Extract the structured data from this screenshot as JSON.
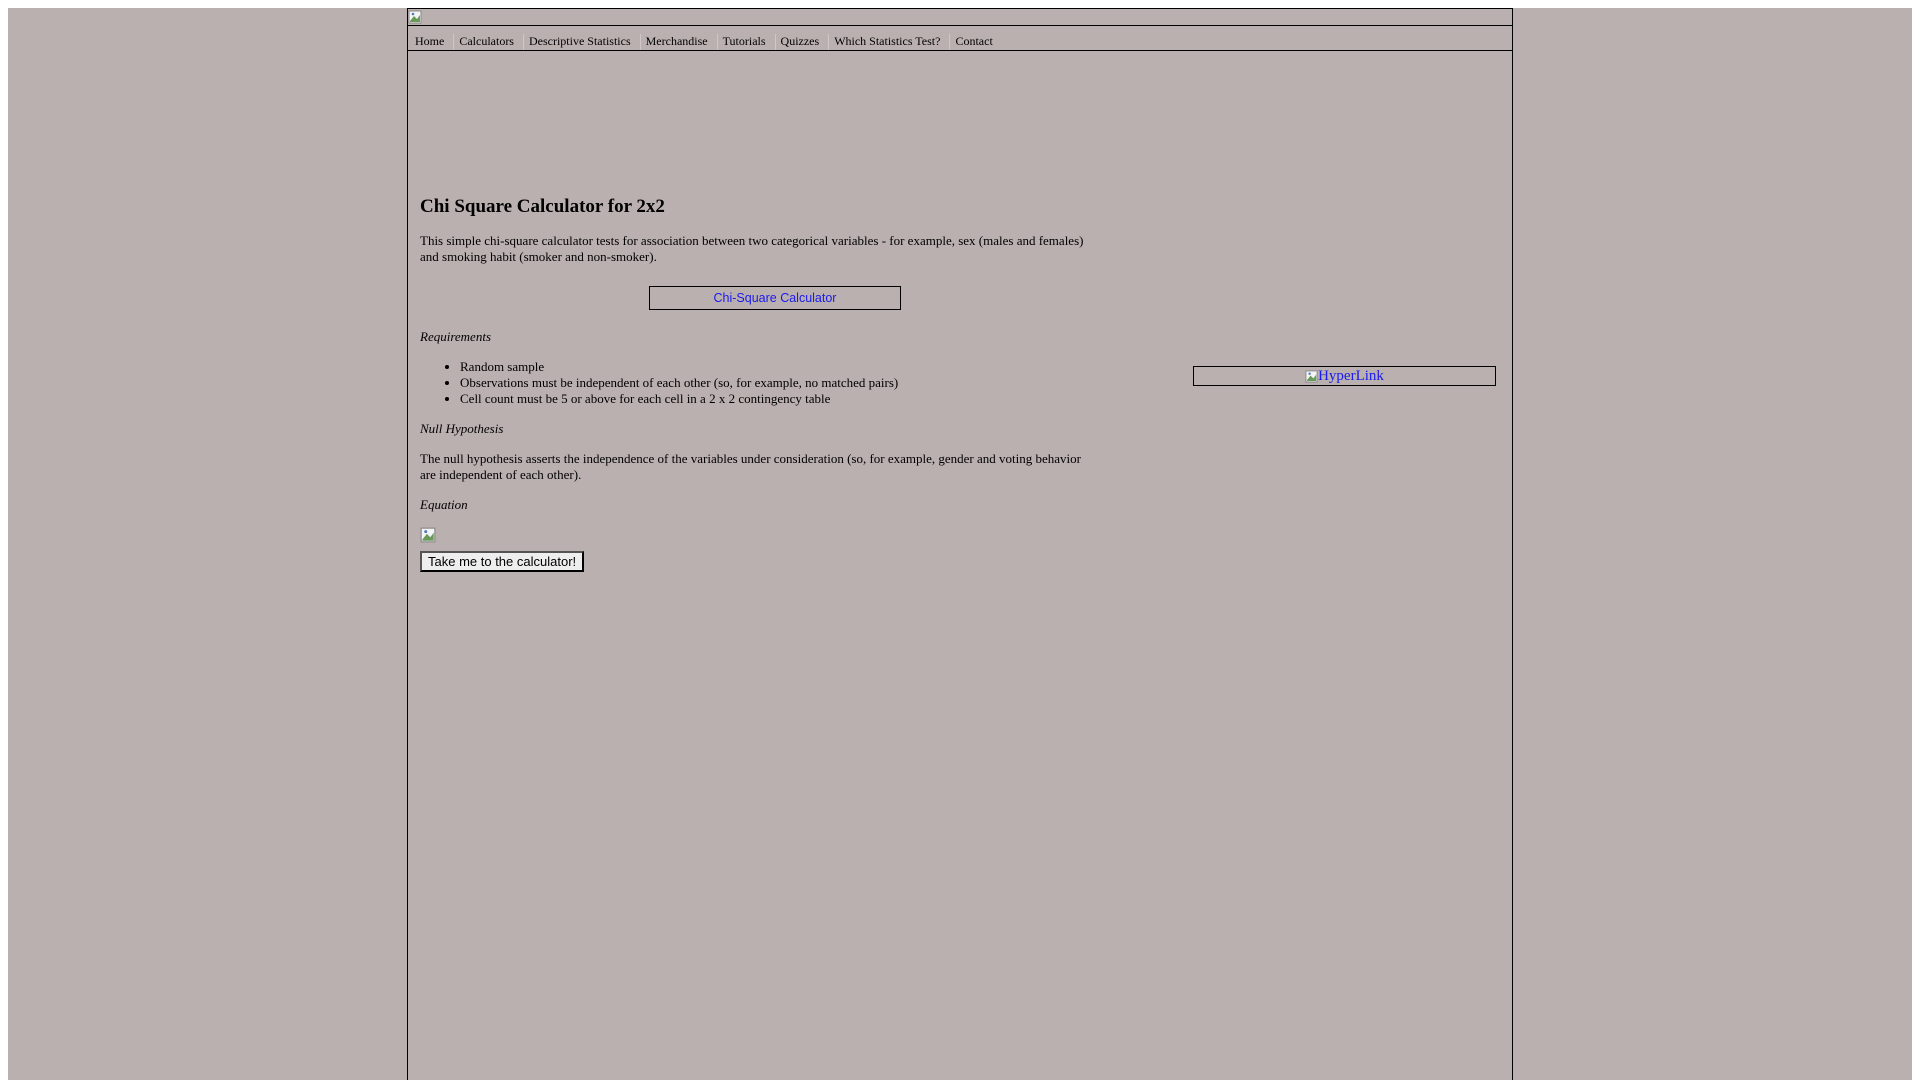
{
  "nav": {
    "items": [
      {
        "label": "Home"
      },
      {
        "label": "Calculators"
      },
      {
        "label": "Descriptive Statistics"
      },
      {
        "label": "Merchandise"
      },
      {
        "label": "Tutorials"
      },
      {
        "label": "Quizzes"
      },
      {
        "label": "Which Statistics Test?"
      },
      {
        "label": "Contact"
      }
    ]
  },
  "main": {
    "title": "Chi Square Calculator for 2x2",
    "intro": "This simple chi-square calculator tests for association between two categorical variables - for example, sex (males and females) and smoking habit (smoker and non-smoker).",
    "calc_link": "Chi-Square Calculator",
    "requirements_heading": "Requirements",
    "requirements": [
      "Random sample",
      "Observations must be independent of each other (so, for example, no matched pairs)",
      "Cell count must be 5 or above for each cell in a 2 x 2 contingency table"
    ],
    "null_heading": "Null Hypothesis",
    "null_text": "The null hypothesis asserts the independence of the variables under consideration (so, for example, gender and voting behavior are independent of each other).",
    "equation_heading": "Equation",
    "button_label": "Take me to the calculator!"
  },
  "sidebar": {
    "hyperlink_label": "HyperLink"
  },
  "colors": {
    "background": "#bbb0b0",
    "link": "#1a1aee"
  }
}
